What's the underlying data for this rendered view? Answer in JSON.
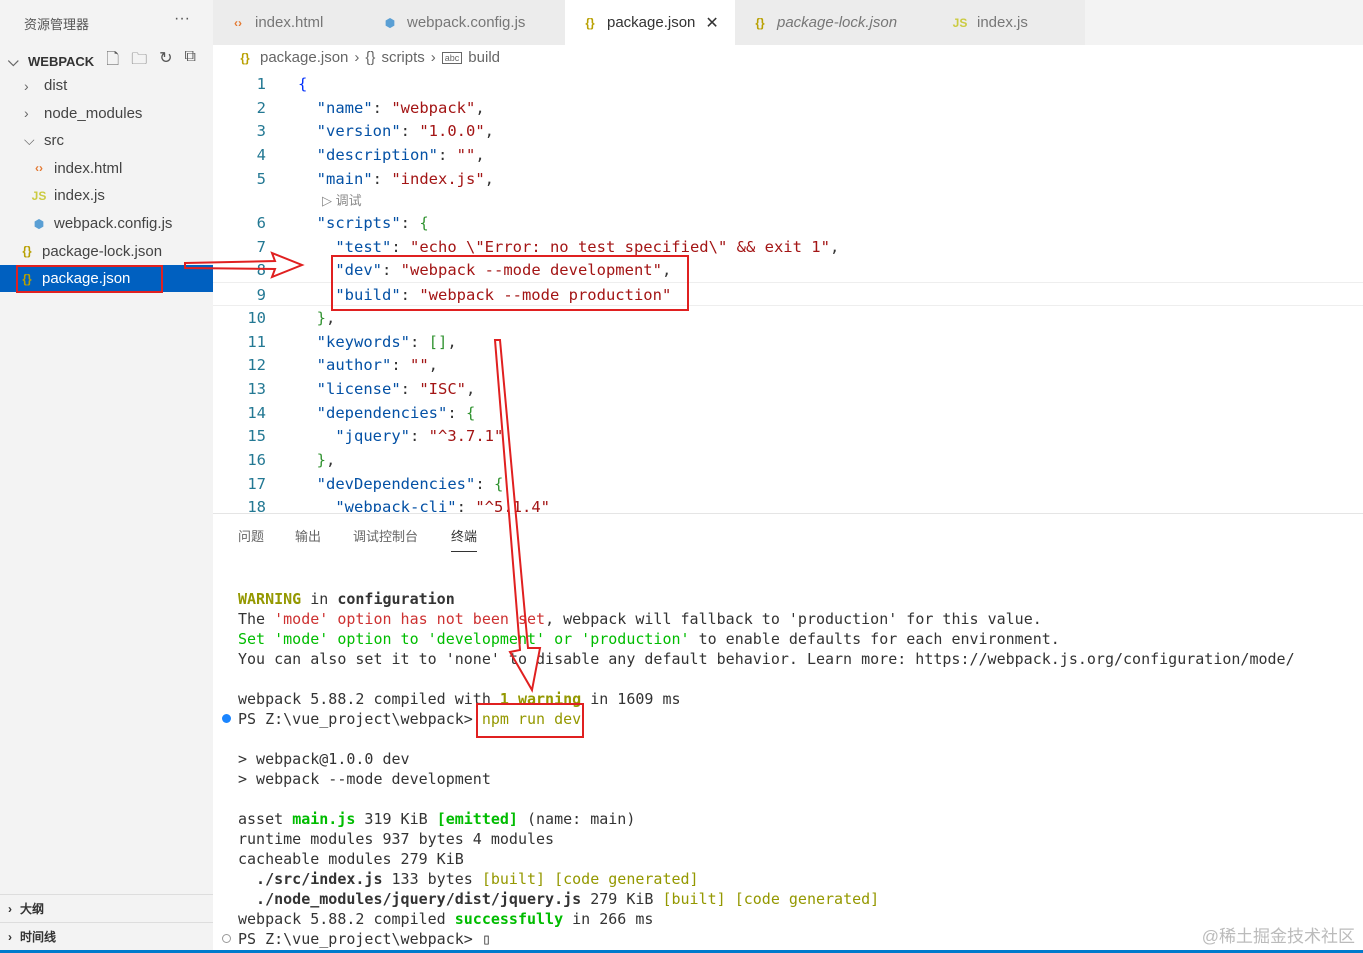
{
  "sidebar": {
    "title": "资源管理器",
    "more": "···",
    "folder": "WEBPACK",
    "items": [
      {
        "label": "dist",
        "type": "folder",
        "icon": "chevron-right"
      },
      {
        "label": "node_modules",
        "type": "folder",
        "icon": "chevron-right"
      },
      {
        "label": "src",
        "type": "folder",
        "icon": "chevron-down"
      },
      {
        "label": "index.html",
        "type": "html"
      },
      {
        "label": "index.js",
        "type": "js"
      },
      {
        "label": "webpack.config.js",
        "type": "webpack"
      },
      {
        "label": "package-lock.json",
        "type": "json"
      },
      {
        "label": "package.json",
        "type": "json",
        "selected": true
      }
    ],
    "outline": "大纲",
    "timeline": "时间线"
  },
  "tabs": [
    {
      "label": "index.html"
    },
    {
      "label": "webpack.config.js"
    },
    {
      "label": "package.json",
      "active": true
    },
    {
      "label": "package-lock.json"
    },
    {
      "label": "index.js"
    }
  ],
  "breadcrumb": [
    "package.json",
    "scripts",
    "build"
  ],
  "codelens": "调试",
  "code": [
    {
      "n": "1",
      "h": "<span class='bb'>{</span>"
    },
    {
      "n": "2",
      "h": "  <span class='k'>\"name\"</span>: <span class='s'>\"webpack\"</span>,"
    },
    {
      "n": "3",
      "h": "  <span class='k'>\"version\"</span>: <span class='s'>\"1.0.0\"</span>,"
    },
    {
      "n": "4",
      "h": "  <span class='k'>\"description\"</span>: <span class='s'>\"\"</span>,"
    },
    {
      "n": "5",
      "h": "  <span class='k'>\"main\"</span>: <span class='s'>\"index.js\"</span>,"
    },
    {
      "n": "6",
      "h": "  <span class='k'>\"scripts\"</span>: <span class='b'>{</span>"
    },
    {
      "n": "7",
      "h": "    <span class='k'>\"test\"</span>: <span class='s'>\"echo \\\"Error: no test specified\\\" &amp;&amp; exit 1\"</span>,"
    },
    {
      "n": "8",
      "h": "    <span class='k'>\"dev\"</span>: <span class='s'>\"webpack --mode development\"</span>,"
    },
    {
      "n": "9",
      "h": "    <span class='k'>\"build\"</span>: <span class='s'>\"webpack --mode production\"</span>"
    },
    {
      "n": "10",
      "h": "  <span class='b'>}</span>,"
    },
    {
      "n": "11",
      "h": "  <span class='k'>\"keywords\"</span>: <span class='b'>[]</span>,"
    },
    {
      "n": "12",
      "h": "  <span class='k'>\"author\"</span>: <span class='s'>\"\"</span>,"
    },
    {
      "n": "13",
      "h": "  <span class='k'>\"license\"</span>: <span class='s'>\"ISC\"</span>,"
    },
    {
      "n": "14",
      "h": "  <span class='k'>\"dependencies\"</span>: <span class='b'>{</span>"
    },
    {
      "n": "15",
      "h": "    <span class='k'>\"jquery\"</span>: <span class='s'>\"^3.7.1\"</span>"
    },
    {
      "n": "16",
      "h": "  <span class='b'>}</span>,"
    },
    {
      "n": "17",
      "h": "  <span class='k'>\"devDependencies\"</span>: <span class='b'>{</span>"
    },
    {
      "n": "18",
      "h": "    <span class='k'>\"webpack-cli\"</span>: <span class='s'>\"^5.1.4\"</span>"
    }
  ],
  "panel_tabs": [
    "问题",
    "输出",
    "调试控制台",
    "终端"
  ],
  "terminal": [
    [
      [
        "WARNING",
        "#949800",
        1
      ],
      [
        " in ",
        ""
      ],
      [
        "configuration",
        "",
        1
      ]
    ],
    [
      [
        "The ",
        ""
      ],
      [
        "'mode' option has not been set",
        "#cd3131"
      ],
      [
        ", webpack will fallback to 'production' for this value.",
        ""
      ]
    ],
    [
      [
        "Set 'mode' option to 'development' or 'production'",
        "#00bc00"
      ],
      [
        " to enable defaults for each environment.",
        ""
      ]
    ],
    [
      [
        "You can also set it to 'none' to disable any default behavior. Learn more: https://webpack.js.org/configuration/mode/",
        ""
      ]
    ],
    [
      [
        "",
        ""
      ]
    ],
    [
      [
        "webpack 5.88.2 compiled with ",
        ""
      ],
      [
        "1 warning",
        "#949800",
        1
      ],
      [
        " in 1609 ms",
        ""
      ]
    ],
    [
      [
        "PS Z:\\vue_project\\webpack> ",
        ""
      ],
      [
        "npm run dev",
        "#949800"
      ]
    ],
    [
      [
        "",
        ""
      ]
    ],
    [
      [
        "> webpack@1.0.0 dev",
        ""
      ]
    ],
    [
      [
        "> webpack --mode development",
        ""
      ]
    ],
    [
      [
        "",
        ""
      ]
    ],
    [
      [
        "asset ",
        ""
      ],
      [
        "main.js",
        "#00bc00",
        1
      ],
      [
        " 319 KiB ",
        ""
      ],
      [
        "[emitted]",
        "#00bc00",
        1
      ],
      [
        " (name: main)",
        ""
      ]
    ],
    [
      [
        "runtime modules 937 bytes 4 modules",
        ""
      ]
    ],
    [
      [
        "cacheable modules 279 KiB",
        ""
      ]
    ],
    [
      [
        "  ./src/index.js",
        "",
        1
      ],
      [
        " 133 bytes ",
        ""
      ],
      [
        "[built] [code generated]",
        "#949800"
      ]
    ],
    [
      [
        "  ./node_modules/jquery/dist/jquery.js",
        "",
        1
      ],
      [
        " 279 KiB ",
        ""
      ],
      [
        "[built] [code generated]",
        "#949800"
      ]
    ],
    [
      [
        "webpack 5.88.2 compiled ",
        ""
      ],
      [
        "successfully",
        "#00bc00",
        1
      ],
      [
        " in 266 ms",
        ""
      ]
    ],
    [
      [
        "PS Z:\\vue_project\\webpack> ",
        ""
      ],
      [
        "▯",
        ""
      ]
    ]
  ],
  "watermark": "@稀土掘金技术社区",
  "colors": {
    "accent": "#007acc",
    "selection": "#0060c0",
    "annotation": "#e02020"
  }
}
